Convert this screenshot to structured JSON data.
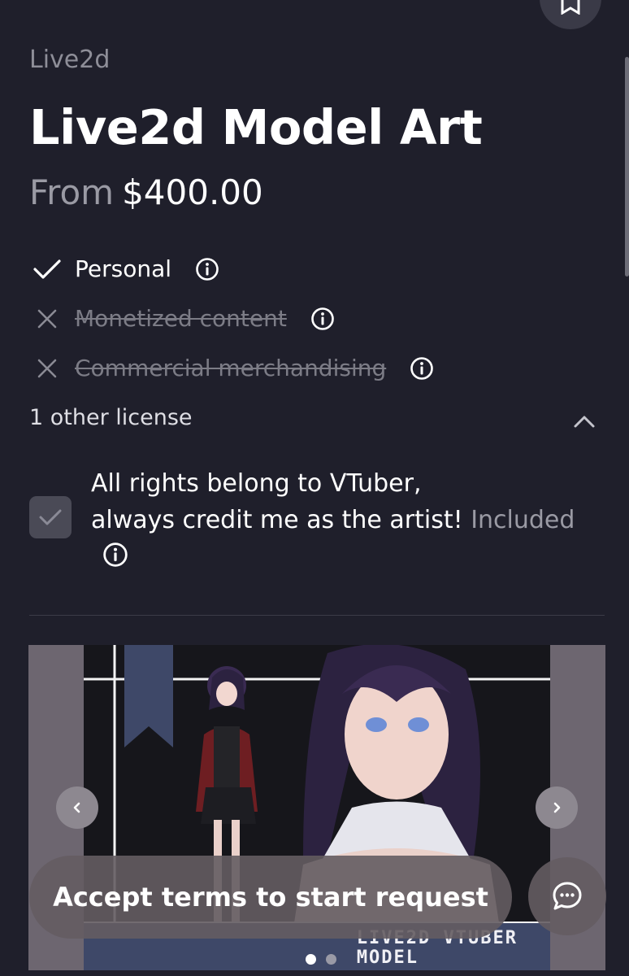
{
  "header": {
    "category": "Live2d",
    "title": "Live2d Model Art"
  },
  "price": {
    "prefix": "From",
    "amount": "$400.00"
  },
  "licenses": [
    {
      "label": "Personal",
      "included": true
    },
    {
      "label": "Monetized content",
      "included": false
    },
    {
      "label": "Commercial merchandising",
      "included": false
    }
  ],
  "other_licenses": {
    "label": "1 other license",
    "expanded": true
  },
  "terms": {
    "line1": "All rights belong to VTuber,",
    "line2": "always credit me as the artist!",
    "status": "Included",
    "checked": true
  },
  "gallery": {
    "slide_caption_line1": "LIVE2D VTUBER",
    "slide_caption_line2": "MODEL",
    "slide_count": 2,
    "active_slide": 1
  },
  "actions": {
    "cta_label": "Accept terms to start request"
  },
  "icons": {
    "top_action": "bookmark-icon",
    "check": "check-icon",
    "cross": "x-icon",
    "info": "info-icon",
    "collapse": "chevron-up-icon",
    "prev": "chevron-left-icon",
    "next": "chevron-right-icon",
    "chat": "chat-bubble-icon"
  },
  "colors": {
    "background": "#1f1f2b",
    "muted_text": "#9a9aa4",
    "banner": "#3e4868"
  }
}
